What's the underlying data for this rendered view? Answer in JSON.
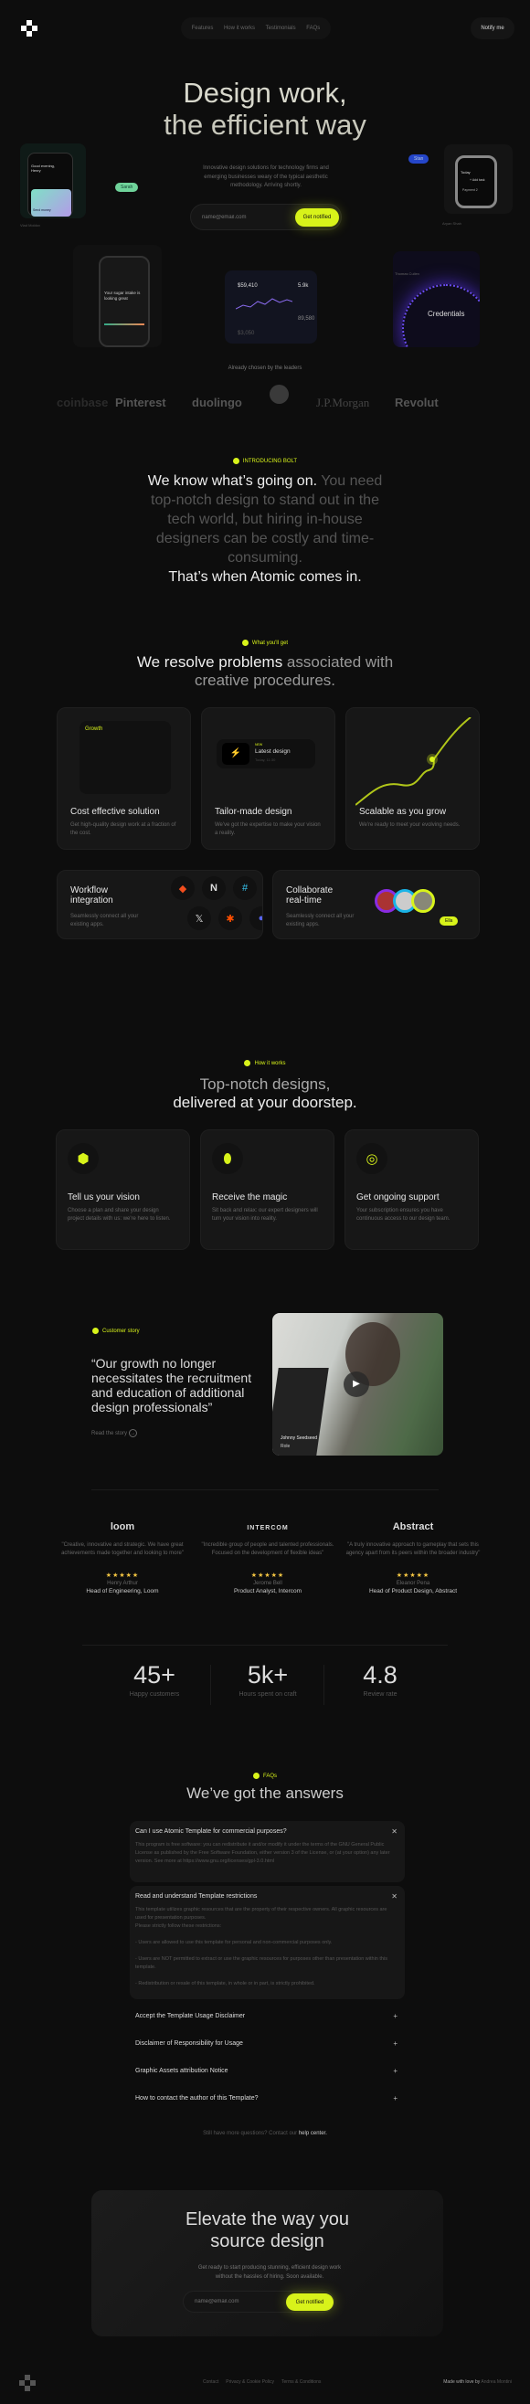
{
  "nav": {
    "links": [
      "Features",
      "How it works",
      "Testimonials",
      "FAQs"
    ],
    "notify": "Notify me"
  },
  "hero": {
    "title_1": "Design work,",
    "title_2": "the efficient way",
    "subtitle": "Innovative design solutions for technology firms and emerging businesses weary of the typical aesthetic methodology. Arriving shortly.",
    "email_placeholder": "name@email.com",
    "cta": "Get notified",
    "mock": {
      "phone_greeting": "Good evening, Henry",
      "send_money": "Send money",
      "left_caption": "Vlad Moldov",
      "sarah": "Sarah",
      "stan": "Stan",
      "right_caption": "Aryan Shah",
      "watch_title": "Today",
      "watch_add": "+ Add task",
      "watch_item": "Payment 2",
      "sugar": "Your sugar intake is looking great",
      "amount_1": "$59,410",
      "amount_2": "5.9k",
      "amount_3": "89,580",
      "amount_4": "$3,050",
      "cred_user": "Thomas Cullen",
      "credentials": "Credentials"
    }
  },
  "leaders": {
    "label": "Already chosen by the leaders",
    "logos": [
      "coinbase",
      "Pinterest",
      "duolingo",
      "",
      "J.P.Morgan",
      "Revolut"
    ]
  },
  "intro": {
    "tag": "INTRODUCING BOLT",
    "lead": "We know what’s going on.",
    "body": " You need top-notch design to stand out in the tech world, but hiring in-house designers can be costly and time-consuming.",
    "close": "That’s when Atomic comes in."
  },
  "features": {
    "tag": "What you'll get",
    "heading_1": "We resolve problems",
    "heading_2": " associated with creative procedures.",
    "cards": [
      {
        "title": "Cost effective solution",
        "desc": "Get high-quality design work at a fraction of the cost.",
        "widget": "Growth"
      },
      {
        "title": "Tailor-made design",
        "desc": "We've got the expertise to make your vision a reality.",
        "widget_badge": "NEW",
        "widget": "Latest design",
        "widget_time": "Today, 11:30"
      },
      {
        "title": "Scalable as you grow",
        "desc": "We're ready to meet your evolving needs."
      },
      {
        "title": "Workflow integration",
        "desc": "Seamlessly connect all your existing apps."
      },
      {
        "title": "Collaborate real-time",
        "desc": "Seamlessly connect all your existing apps.",
        "cursor_name": "Ella"
      }
    ]
  },
  "how": {
    "tag": "How it works",
    "heading_1": "Top-notch designs,",
    "heading_2": "delivered at your doorstep.",
    "steps": [
      {
        "title": "Tell us your vision",
        "desc": "Choose a plan and share your design project details with us: we're here to listen.",
        "icon": "cube-icon"
      },
      {
        "title": "Receive the magic",
        "desc": "Sit back and relax: our expert designers will turn your vision into reality.",
        "icon": "pill-icon"
      },
      {
        "title": "Get ongoing support",
        "desc": "Your subscription ensures you have continuous access to our design team.",
        "icon": "fingerprint-icon"
      }
    ]
  },
  "story": {
    "tag": "Customer story",
    "quote": "“Our growth no longer necessitates the recruitment and education of additional design professionals”",
    "link": "Read the story",
    "person": "Johnny Seedseed",
    "role": "Role"
  },
  "testimonials": [
    {
      "company": "loom",
      "quote": "\"Creative, innovative and strategic. We have great achievements made together and looking to more\"",
      "stars": 5,
      "name": "Henry Arthur",
      "role": "Head of Engineering, Loom"
    },
    {
      "company": "INTERCOM",
      "quote": "\"Incredible group of people and talented professionals. Focused on the development of flexible ideas\"",
      "stars": 5,
      "name": "Jerome Bell",
      "role": "Product Analyst, Intercom"
    },
    {
      "company": "Abstract",
      "quote": "\"A truly innovative approach to gameplay that sets this agency apart from its peers within the broader industry\"",
      "stars": 5,
      "name": "Eleanor Pena",
      "role": "Head of Product Design, Abstract"
    }
  ],
  "stats": [
    {
      "value": "45+",
      "label": "Happy customers"
    },
    {
      "value": "5k+",
      "label": "Hours spent on craft"
    },
    {
      "value": "4.8",
      "label": "Review rate"
    }
  ],
  "faq": {
    "tag": "FAQs",
    "heading": "We’ve got the answers",
    "items": [
      {
        "q": "Can I use Atomic Template for commercial purposes?",
        "a": "This program is free software: you can redistribute it and/or modify it under the terms of the GNU General Public License as published by the Free Software Foundation, either version 3 of the License, or (at your option) any later version. See more at https://www.gnu.org/licenses/gpl-3.0.html",
        "open": true
      },
      {
        "q": "Read and understand Template restrictions",
        "a": "This template utilizes graphic resources that are the property of their respective owners. All graphic resources are used for presentation purposes.\nPlease strictly follow these restrictions:\n\n- Users are allowed to use this template for personal and non-commercial purposes only.\n\n- Users are NOT permitted to extract or use the graphic resources for purposes other than presentation within this template.\n\n- Redistribution or resale of this template, in whole or in part, is strictly prohibited.",
        "open": true
      },
      {
        "q": "Accept the Template Usage Disclaimer",
        "open": false
      },
      {
        "q": "Disclaimer of Responsibility for Usage",
        "open": false
      },
      {
        "q": "Graphic Assets attribution Notice",
        "open": false
      },
      {
        "q": "How to contact the author of this Template?",
        "open": false
      }
    ],
    "help_prefix": "Still have more questions? Contact our ",
    "help_link": "help center."
  },
  "cta": {
    "title_1": "Elevate the way you",
    "title_2": "source design",
    "subtitle": "Get ready to start producing stunning, efficient design work without the hassles of hiring. Soon available.",
    "email_placeholder": "name@email.com",
    "button": "Get notified"
  },
  "footer": {
    "links": [
      "Contact",
      "Privacy & Cookie Policy",
      "Terms & Conditions"
    ],
    "made_prefix": "Made with love by ",
    "author": "Andrea Montini"
  },
  "colors": {
    "accent": "#d8f31a",
    "background": "#0d0d0d",
    "card": "#171717"
  }
}
